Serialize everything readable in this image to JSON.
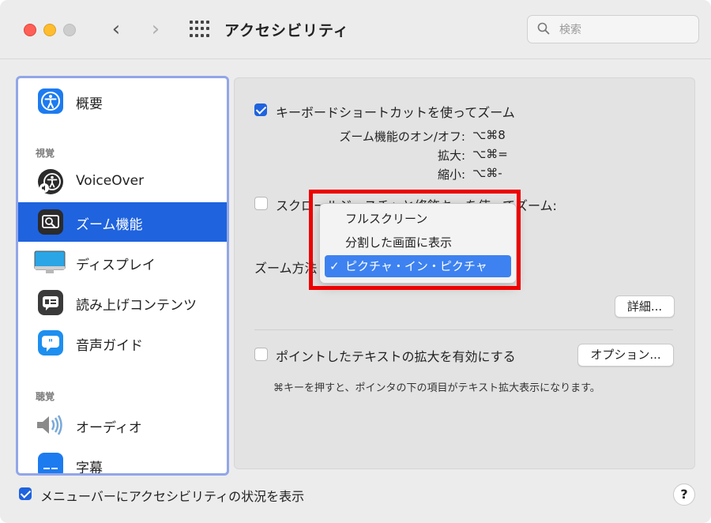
{
  "window": {
    "title": "アクセシビリティ"
  },
  "search": {
    "placeholder": "検索"
  },
  "sidebar": {
    "items": [
      {
        "label": "概要",
        "icon": "accessibility-icon"
      },
      {
        "label": "VoiceOver",
        "icon": "voiceover-icon"
      },
      {
        "label": "ズーム機能",
        "icon": "zoom-icon",
        "selected": true
      },
      {
        "label": "ディスプレイ",
        "icon": "display-icon"
      },
      {
        "label": "読み上げコンテンツ",
        "icon": "spoken-content-icon"
      },
      {
        "label": "音声ガイド",
        "icon": "descriptions-icon"
      },
      {
        "label": "オーディオ",
        "icon": "speaker-icon"
      },
      {
        "label": "字幕",
        "icon": "captions-icon"
      }
    ],
    "sections": {
      "vision": "視覚",
      "hearing": "聴覚"
    }
  },
  "zoom": {
    "shortcut_checkbox_label": "キーボードショートカットを使ってズーム",
    "shortcut_checked": true,
    "shortcuts": [
      {
        "label": "ズーム機能のオン/オフ:",
        "keys": "⌥⌘8"
      },
      {
        "label": "拡大:",
        "keys": "⌥⌘="
      },
      {
        "label": "縮小:",
        "keys": "⌥⌘-"
      }
    ],
    "scroll_gesture_label": "スクロールジェスチャと修飾キーを使ってズーム:",
    "scroll_gesture_checked": false,
    "zoom_style_label": "ズーム方法",
    "zoom_style_options": [
      "フルスクリーン",
      "分割した画面に表示",
      "ピクチャ・イン・ピクチャ"
    ],
    "zoom_style_selected": "ピクチャ・イン・ピクチャ",
    "details_button": "詳細...",
    "hover_text_label": "ポイントしたテキストの拡大を有効にする",
    "hover_text_checked": false,
    "options_button": "オプション...",
    "hover_text_hint": "⌘キーを押すと、ポインタの下の項目がテキスト拡大表示になります。"
  },
  "footer": {
    "menubar_status_label": "メニューバーにアクセシビリティの状況を表示",
    "menubar_status_checked": true,
    "help_label": "?"
  },
  "colors": {
    "accent": "#1f63de",
    "highlight_box": "#ee0000"
  }
}
